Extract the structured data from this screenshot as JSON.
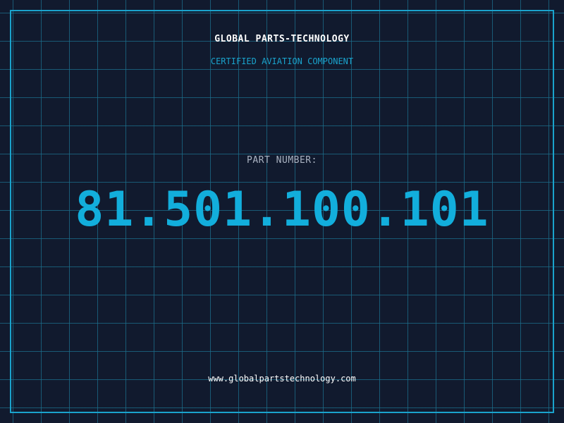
{
  "header": {
    "brand": "GLOBAL PARTS-TECHNOLOGY",
    "tagline": "CERTIFIED AVIATION COMPONENT"
  },
  "part": {
    "label": "PART NUMBER:",
    "number": "81.501.100.101"
  },
  "footer": {
    "url": "www.globalpartstechnology.com"
  },
  "colors": {
    "background": "#111a2e",
    "grid": "#1c6e8c",
    "accent": "#1aa3cc",
    "part_number": "#12aedc",
    "text_light": "#ffffff",
    "text_muted": "#aab3c2"
  }
}
